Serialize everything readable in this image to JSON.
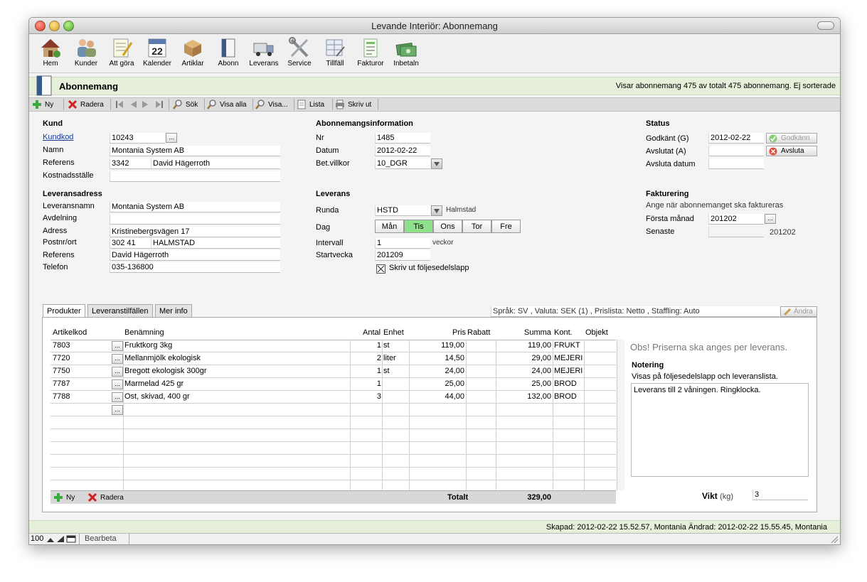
{
  "window": {
    "title": "Levande Interiör: Abonnemang"
  },
  "toolbar": {
    "items": [
      {
        "label": "Hem"
      },
      {
        "label": "Kunder"
      },
      {
        "label": "Att göra"
      },
      {
        "label": "Kalender"
      },
      {
        "label": "Artiklar"
      },
      {
        "label": "Abonn"
      },
      {
        "label": "Leverans"
      },
      {
        "label": "Service"
      },
      {
        "label": "Tillfäll"
      },
      {
        "label": "Fakturor"
      },
      {
        "label": "Inbetaln"
      }
    ],
    "calendar_day": "22"
  },
  "header": {
    "title": "Abonnemang",
    "info": "Visar abonnemang 475 av totalt 475 abonnemang. Ej sorterade"
  },
  "actions": {
    "ny": "Ny",
    "radera": "Radera",
    "sok": "Sök",
    "visa_alla": "Visa alla",
    "visa": "Visa...",
    "lista": "Lista",
    "skriv_ut": "Skriv ut"
  },
  "kund": {
    "heading": "Kund",
    "kundkod_label": "Kundkod",
    "kundkod": "10243",
    "namn_label": "Namn",
    "namn": "Montania System AB",
    "referens_label": "Referens",
    "referens_nr": "3342",
    "referens_namn": "David Hägerroth",
    "kostnadsstalle_label": "Kostnadsställe",
    "kostnadsstalle": ""
  },
  "leveransadress": {
    "heading": "Leveransadress",
    "leveransnamn_label": "Leveransnamn",
    "leveransnamn": "Montania System AB",
    "avdelning_label": "Avdelning",
    "avdelning": "",
    "adress_label": "Adress",
    "adress": "Kristinebergsvägen 17",
    "postnr_label": "Postnr/ort",
    "postnr": "302 41",
    "ort": "HALMSTAD",
    "referens_label": "Referens",
    "referens": "David Hägerroth",
    "telefon_label": "Telefon",
    "telefon": "035-136800"
  },
  "abonnemang": {
    "heading": "Abonnemangsinformation",
    "nr_label": "Nr",
    "nr": "1485",
    "datum_label": "Datum",
    "datum": "2012-02-22",
    "betvillkor_label": "Bet.villkor",
    "betvillkor": "10_DGR"
  },
  "leverans": {
    "heading": "Leverans",
    "runda_label": "Runda",
    "runda": "HSTD",
    "runda_name": "Halmstad",
    "dag_label": "Dag",
    "days": [
      "Mån",
      "Tis",
      "Ons",
      "Tor",
      "Fre"
    ],
    "intervall_label": "Intervall",
    "intervall": "1",
    "intervall_unit": "veckor",
    "startvecka_label": "Startvecka",
    "startvecka": "201209",
    "checkbox_label": "Skriv ut följesedelslapp",
    "selected_color": "#8ee08a"
  },
  "status": {
    "heading": "Status",
    "godkant_label": "Godkänt (G)",
    "godkant": "2012-02-22",
    "godkann_btn": "Godkänn",
    "avslutat_label": "Avslutat (A)",
    "avslutat": "",
    "avsluta_btn": "Avsluta",
    "avsluta_datum_label": "Avsluta datum",
    "avsluta_datum": ""
  },
  "fakturering": {
    "heading": "Fakturering",
    "info": "Ange när abonnemanget ska faktureras",
    "forsta_label": "Första månad",
    "forsta": "201202",
    "senaste_label": "Senaste",
    "senaste": "201202"
  },
  "tabs": [
    {
      "label": "Produkter"
    },
    {
      "label": "Leveranstilfällen"
    },
    {
      "label": "Mer info"
    }
  ],
  "lang_info": "Språk: SV , Valuta: SEK (1) , Prislista: Netto , Staffling: Auto",
  "andra_btn": "Ändra",
  "table": {
    "columns": [
      "Artikelkod",
      "Benämning",
      "Antal",
      "Enhet",
      "Pris",
      "Rabatt",
      "Summa",
      "Kont.",
      "Objekt"
    ],
    "rows": [
      {
        "kod": "7803",
        "namn": "Fruktkorg 3kg",
        "antal": "1",
        "enhet": "st",
        "pris": "119,00",
        "rabatt": "",
        "summa": "119,00",
        "kont": "FRUKT",
        "objekt": ""
      },
      {
        "kod": "7720",
        "namn": "Mellanmjölk ekologisk",
        "antal": "2",
        "enhet": "liter",
        "pris": "14,50",
        "rabatt": "",
        "summa": "29,00",
        "kont": "MEJERI",
        "objekt": ""
      },
      {
        "kod": "7750",
        "namn": "Bregott ekologisk 300gr",
        "antal": "1",
        "enhet": "st",
        "pris": "24,00",
        "rabatt": "",
        "summa": "24,00",
        "kont": "MEJERI",
        "objekt": ""
      },
      {
        "kod": "7787",
        "namn": "Marmelad 425 gr",
        "antal": "1",
        "enhet": "",
        "pris": "25,00",
        "rabatt": "",
        "summa": "25,00",
        "kont": "BROD",
        "objekt": ""
      },
      {
        "kod": "7788",
        "namn": "Ost, skivad, 400 gr",
        "antal": "3",
        "enhet": "",
        "pris": "44,00",
        "rabatt": "",
        "summa": "132,00",
        "kont": "BROD",
        "objekt": ""
      }
    ],
    "ny": "Ny",
    "radera": "Radera",
    "totalt_label": "Totalt",
    "totalt": "329,00"
  },
  "side": {
    "obs": "Obs! Priserna ska anges per leverans.",
    "notering_label": "Notering",
    "notering_sub": "Visas på följesedelslapp och leveranslista.",
    "notering": "Leverans till 2 våningen. Ringklocka.",
    "vikt_label": "Vikt",
    "vikt_unit": "(kg)",
    "vikt": "3"
  },
  "statusbar": {
    "text": "Skapad: 2012-02-22 15.52.57, Montania Ändrad: 2012-02-22 15.55.45, Montania"
  },
  "bottombar": {
    "zoom": "100",
    "mode": "Bearbeta"
  }
}
